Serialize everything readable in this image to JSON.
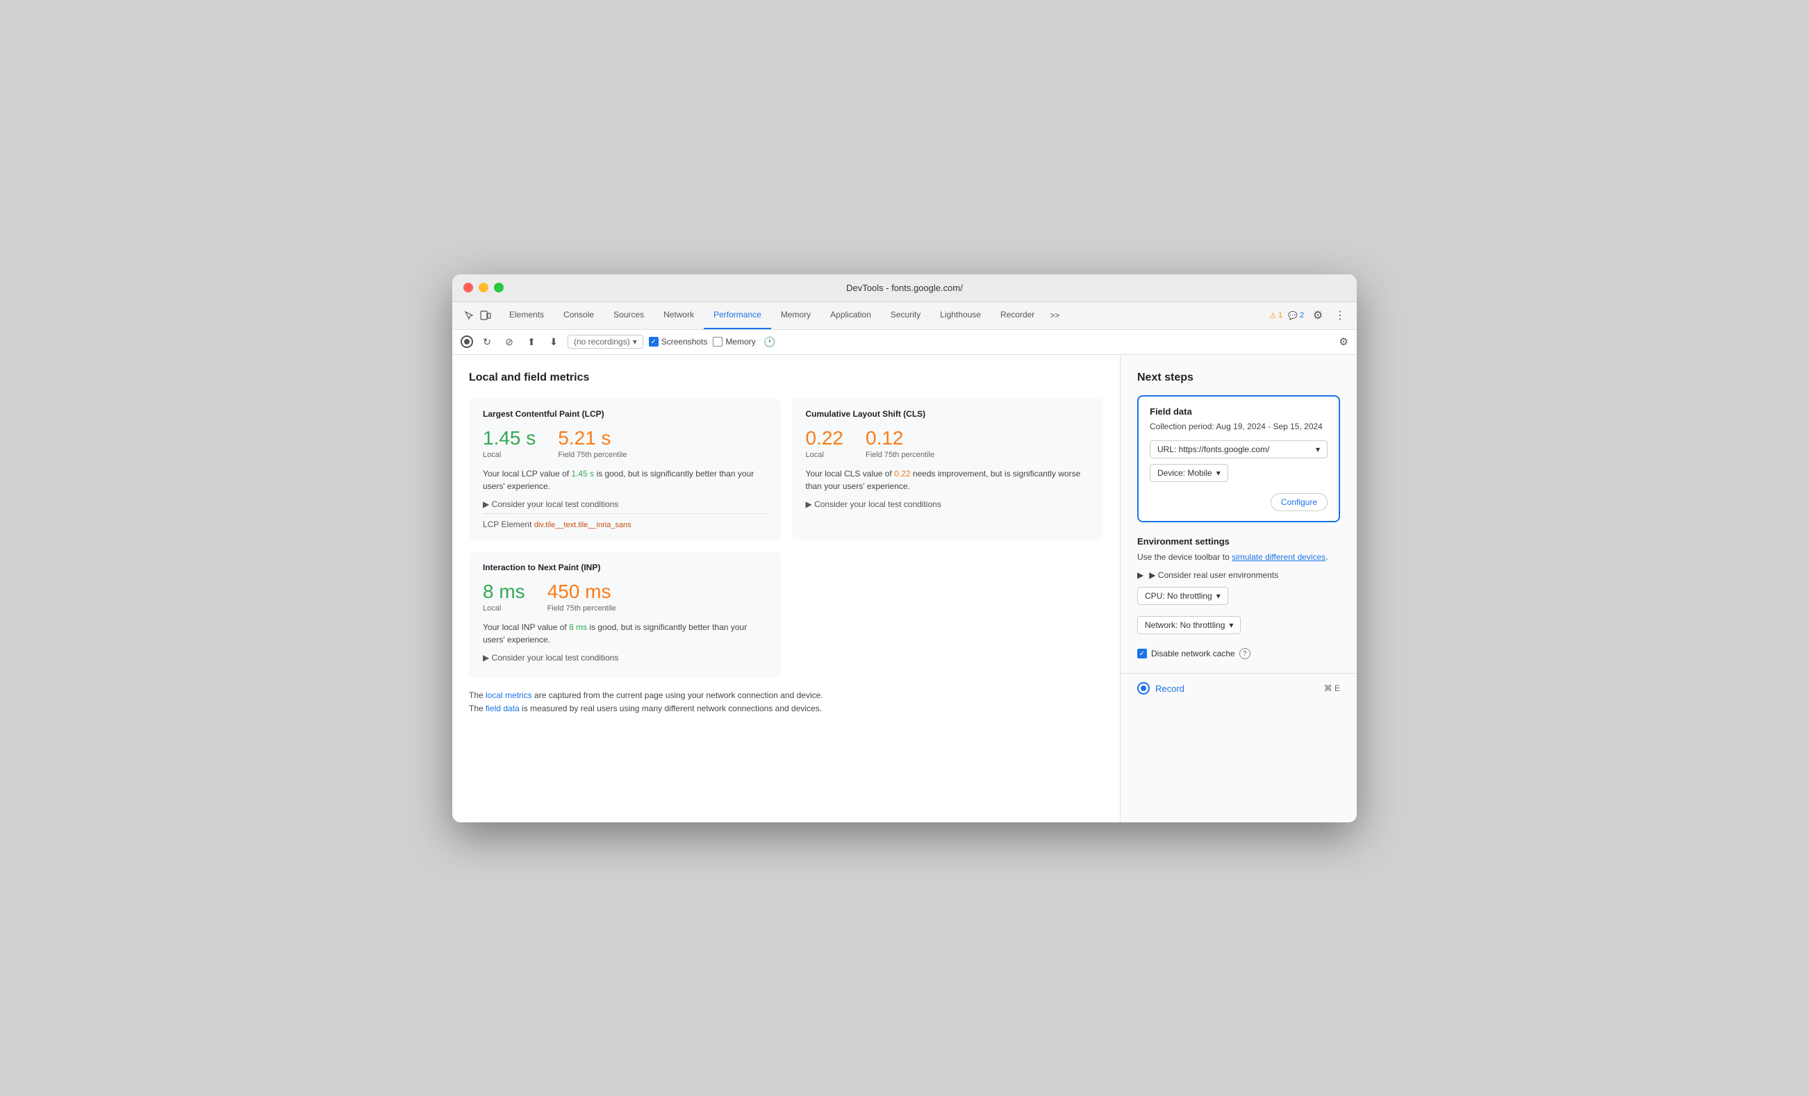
{
  "window": {
    "title": "DevTools - fonts.google.com/"
  },
  "tabs": {
    "items": [
      {
        "label": "Elements",
        "active": false
      },
      {
        "label": "Console",
        "active": false
      },
      {
        "label": "Sources",
        "active": false
      },
      {
        "label": "Network",
        "active": false
      },
      {
        "label": "Performance",
        "active": true
      },
      {
        "label": "Memory",
        "active": false
      },
      {
        "label": "Application",
        "active": false
      },
      {
        "label": "Security",
        "active": false
      },
      {
        "label": "Lighthouse",
        "active": false
      },
      {
        "label": "Recorder",
        "active": false
      }
    ],
    "more": ">>",
    "warning_count": "1",
    "info_count": "2"
  },
  "toolbar2": {
    "recordings_placeholder": "(no recordings)",
    "screenshots_label": "Screenshots",
    "memory_label": "Memory"
  },
  "left_panel": {
    "section_title": "Local and field metrics",
    "lcp_card": {
      "title": "Largest Contentful Paint (LCP)",
      "local_value": "1.45 s",
      "field_value": "5.21 s",
      "local_label": "Local",
      "field_label": "Field 75th percentile",
      "description_1": "Your local LCP value of ",
      "description_highlight_1": "1.45 s",
      "description_2": " is good, but is significantly better than your users' experience.",
      "consider_label": "▶ Consider your local test conditions",
      "lcp_element_label": "LCP Element",
      "lcp_element_value": "div.tile__text.tile__inria_sans"
    },
    "cls_card": {
      "title": "Cumulative Layout Shift (CLS)",
      "local_value": "0.22",
      "field_value": "0.12",
      "local_label": "Local",
      "field_label": "Field 75th percentile",
      "description_1": "Your local CLS value of ",
      "description_highlight_1": "0.22",
      "description_2": " needs improvement, but is significantly worse than your users' experience.",
      "consider_label": "▶ Consider your local test conditions"
    },
    "inp_card": {
      "title": "Interaction to Next Paint (INP)",
      "local_value": "8 ms",
      "field_value": "450 ms",
      "local_label": "Local",
      "field_label": "Field 75th percentile",
      "description_1": "Your local INP value of ",
      "description_highlight_1": "8 ms",
      "description_2": " is good, but is significantly better than your users' experience.",
      "consider_label": "▶ Consider your local test conditions"
    },
    "bottom_note_1": "The ",
    "bottom_link_1": "local metrics",
    "bottom_note_2": " are captured from the current page using your network connection and device.",
    "bottom_note_3": "The ",
    "bottom_link_2": "field data",
    "bottom_note_4": " is measured by real users using many different network connections and devices."
  },
  "right_panel": {
    "next_steps_title": "Next steps",
    "field_data": {
      "title": "Field data",
      "period": "Collection period: Aug 19, 2024 - Sep 15, 2024",
      "url_label": "URL: https://fonts.google.com/",
      "device_label": "Device: Mobile",
      "configure_label": "Configure"
    },
    "env_settings": {
      "title": "Environment settings",
      "description_1": "Use the device toolbar to ",
      "link_text": "simulate different devices",
      "description_2": ".",
      "consider_label": "▶ Consider real user environments",
      "cpu_label": "CPU: No throttling",
      "network_label": "Network: No throttling",
      "disable_cache_label": "Disable network cache"
    },
    "record": {
      "label": "Record",
      "shortcut": "⌘ E"
    }
  }
}
